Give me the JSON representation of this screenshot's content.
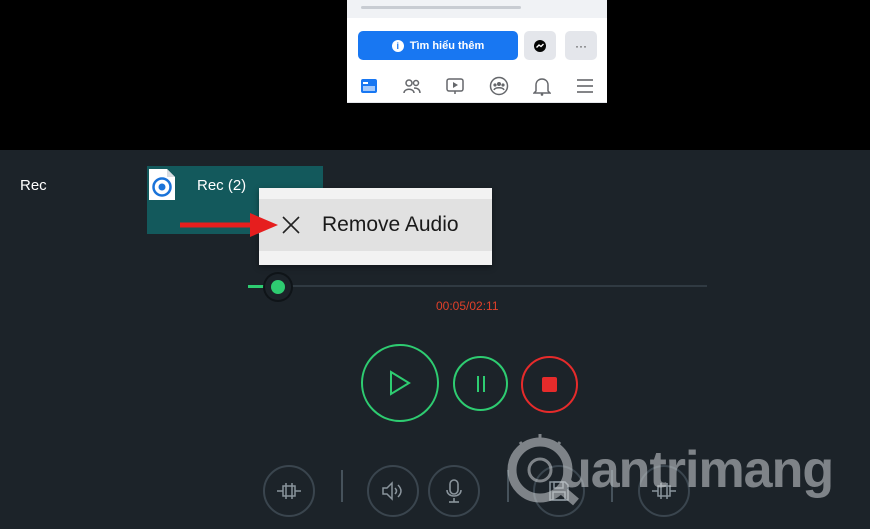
{
  "fb_preview": {
    "learn_more_label": "Tìm hiểu thêm",
    "more_label": "···",
    "nav_icons": [
      "feed-icon",
      "friends-icon",
      "watch-icon",
      "groups-icon",
      "bell-icon",
      "menu-icon"
    ]
  },
  "track": {
    "label": "Rec"
  },
  "clip": {
    "name": "Rec (2)"
  },
  "context_menu": {
    "items": [
      {
        "label": "Remove Audio",
        "icon": "close-icon"
      }
    ]
  },
  "player": {
    "time": "00:05/02:11",
    "progress_fraction": 0.065
  },
  "colors": {
    "accent_green": "#2ecc71",
    "stop_red": "#e62b2b",
    "time_red": "#e0402a",
    "clip_teal": "#13595c",
    "facebook_blue": "#1877f2"
  },
  "toolbar": {
    "icons": [
      "trim-icon",
      "speaker-icon",
      "microphone-icon",
      "save-icon",
      "trim-icon"
    ]
  },
  "watermark": {
    "text": "uantrimang"
  }
}
